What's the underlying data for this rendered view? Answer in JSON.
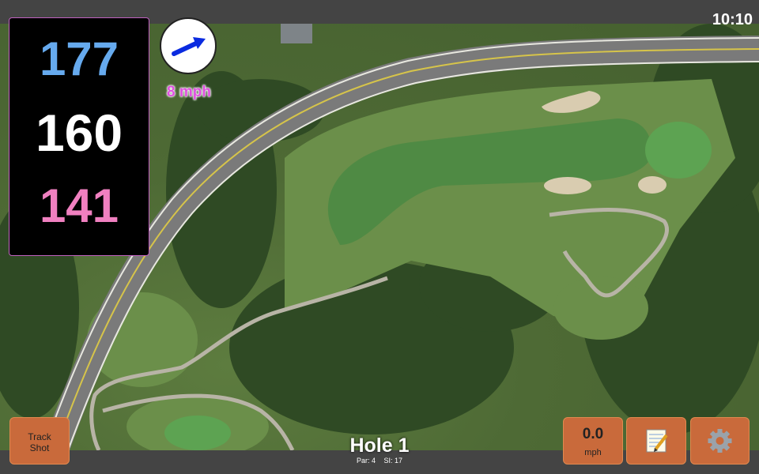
{
  "status": {
    "time": "10:10"
  },
  "distances": {
    "back": "177",
    "middle": "160",
    "front": "141"
  },
  "wind": {
    "speed_text": "8 mph",
    "arrow_icon": "arrow-right-up-icon"
  },
  "hole": {
    "title": "Hole 1",
    "par": "Par: 4",
    "si": "SI: 17"
  },
  "buttons": {
    "track_shot_line1": "Track",
    "track_shot_line2": "Shot",
    "speed_value": "0.0",
    "speed_unit": "mph",
    "notes_icon": "notepad-icon",
    "settings_icon": "gear-icon"
  },
  "colors": {
    "back": "#66aaee",
    "middle": "#ffffff",
    "front": "#f080c0",
    "wind_text": "#e050e0",
    "button": "#c96a3b"
  }
}
